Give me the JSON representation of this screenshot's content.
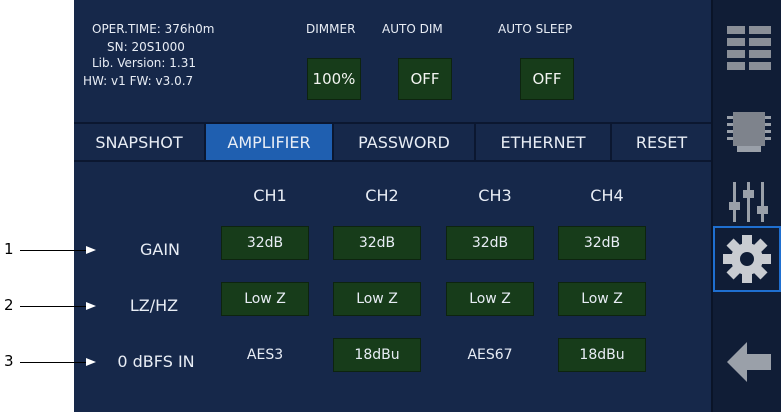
{
  "info": {
    "oper_time": "OPER.TIME: 376h0m",
    "sn": "SN: 20S1000",
    "lib_version": "Lib. Version: 1.31",
    "hw_fw": "HW: v1  FW: v3.0.7"
  },
  "header": {
    "dimmer_label": "DIMMER",
    "auto_dim_label": "AUTO DIM",
    "auto_sleep_label": "AUTO SLEEP",
    "dimmer_value": "100%",
    "auto_dim_value": "OFF",
    "auto_sleep_value": "OFF"
  },
  "tabs": [
    "SNAPSHOT",
    "AMPLIFIER",
    "PASSWORD",
    "ETHERNET",
    "RESET"
  ],
  "active_tab": "AMPLIFIER",
  "channels": [
    "CH1",
    "CH2",
    "CH3",
    "CH4"
  ],
  "rows": [
    {
      "label": "GAIN",
      "callout": "1",
      "values": [
        "32dB",
        "32dB",
        "32dB",
        "32dB"
      ],
      "styled": [
        true,
        true,
        true,
        true
      ]
    },
    {
      "label": "LZ/HZ",
      "callout": "2",
      "values": [
        "Low Z",
        "Low Z",
        "Low Z",
        "Low Z"
      ],
      "styled": [
        true,
        true,
        true,
        true
      ]
    },
    {
      "label": "0 dBFS IN",
      "callout": "3",
      "values": [
        "AES3",
        "18dBu",
        "AES67",
        "18dBu"
      ],
      "styled": [
        false,
        true,
        false,
        true
      ]
    }
  ],
  "sidebar_icons": [
    "list-icon",
    "chip-icon",
    "sliders-icon",
    "gear-icon",
    "back-arrow-icon"
  ],
  "colors": {
    "panel": "#16284a",
    "active_tab": "#1f5fb0",
    "value_bg": "#173c1a",
    "accent": "#1f6fd0"
  }
}
